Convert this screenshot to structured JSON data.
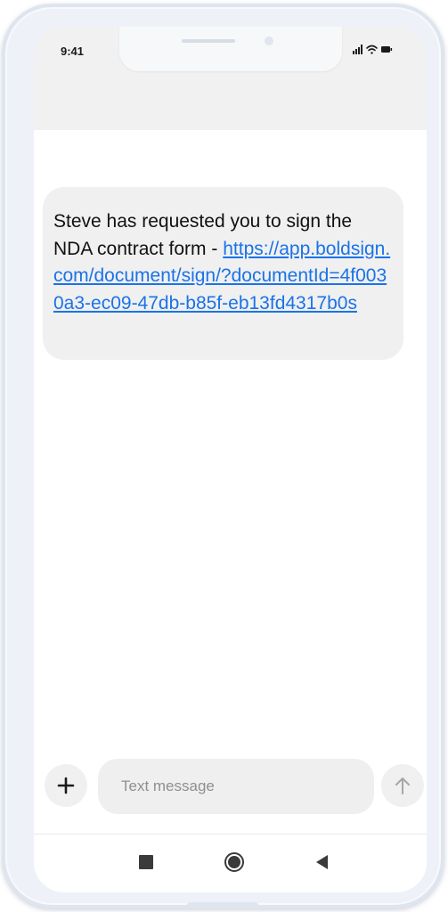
{
  "status_bar": {
    "time": "9:41",
    "icons": [
      "signal-icon",
      "wifi-icon",
      "battery-icon"
    ]
  },
  "message": {
    "text": "Steve has requested you to sign the NDA contract form - ",
    "link": "https://app.boldsign.com/document/sign/?documentId=4f0030a3-ec09-47db-b85f-eb13fd4317b0s"
  },
  "composer": {
    "placeholder": "Text message",
    "add_icon": "plus-icon",
    "send_icon": "arrow-up-icon"
  },
  "navigation": {
    "icons": [
      "square-icon",
      "circle-home-icon",
      "triangle-back-icon"
    ]
  },
  "colors": {
    "link": "#1a73e8",
    "bubble_background": "#f0f0f0",
    "header_background": "#f1f1f1",
    "frame": "#eef2f8"
  }
}
